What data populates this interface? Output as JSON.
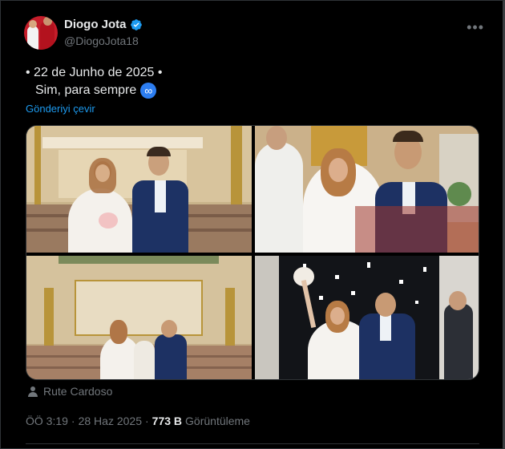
{
  "post": {
    "display_name": "Diogo Jota",
    "handle": "@DiogoJota18",
    "text_line1": "• 22 de Junho de 2025 •",
    "text_line2": "Sim, para sempre",
    "emoji_icon": "infinity-emoji",
    "emoji_glyph": "∞",
    "translate_label": "Gönderiyi çevir",
    "photo_credit": "Rute Cardoso",
    "time": "ÖÖ 3:19",
    "separator": "·",
    "date": "28 Haz 2025",
    "views_count": "773 B",
    "views_label": "Görüntüleme"
  },
  "colors": {
    "background": "#000000",
    "text": "#e7e9ea",
    "muted": "#71767b",
    "link": "#1d9bf0",
    "verified": "#1d9bf0",
    "border": "#2f3336"
  },
  "icons": [
    "verified-badge-icon",
    "more-options-icon",
    "person-icon"
  ]
}
